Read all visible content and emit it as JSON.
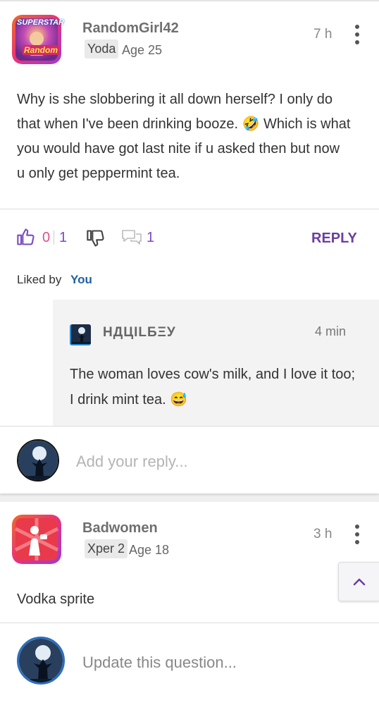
{
  "post1": {
    "username": "RandomGirl42",
    "badge": "Yoda",
    "age": "Age 25",
    "time": "7 h",
    "avatar_text_top": "SUPERSTAR",
    "avatar_text_bottom": "Random",
    "text_lines": [
      "Why is she slobbering it all down herself? I only do",
      "that when I've been drinking booze. 🤣 Which is what",
      "you would have got last nite if u asked then but now",
      "u only get peppermint tea."
    ],
    "like_count": "0",
    "like_total": "1",
    "comment_count": "1",
    "reply_label": "REPLY",
    "liked_by_label": "Liked by",
    "liked_by_user": "You"
  },
  "reply": {
    "username": "НДЦILБΞУ",
    "time": "4 min",
    "text_lines": [
      "The woman loves cow's milk, and I love it too;",
      "I drink mint tea. 😅"
    ]
  },
  "add_reply": {
    "placeholder": "Add your reply..."
  },
  "post2": {
    "username": "Badwomen",
    "badge": "Xper 2",
    "age": "Age 18",
    "time": "3 h",
    "text": "Vodka sprite"
  },
  "update_question": {
    "placeholder": "Update this question..."
  },
  "colors": {
    "accent": "#6a3fa0",
    "liked_by_user": "#1f5ea8",
    "count": "#e0508a"
  }
}
